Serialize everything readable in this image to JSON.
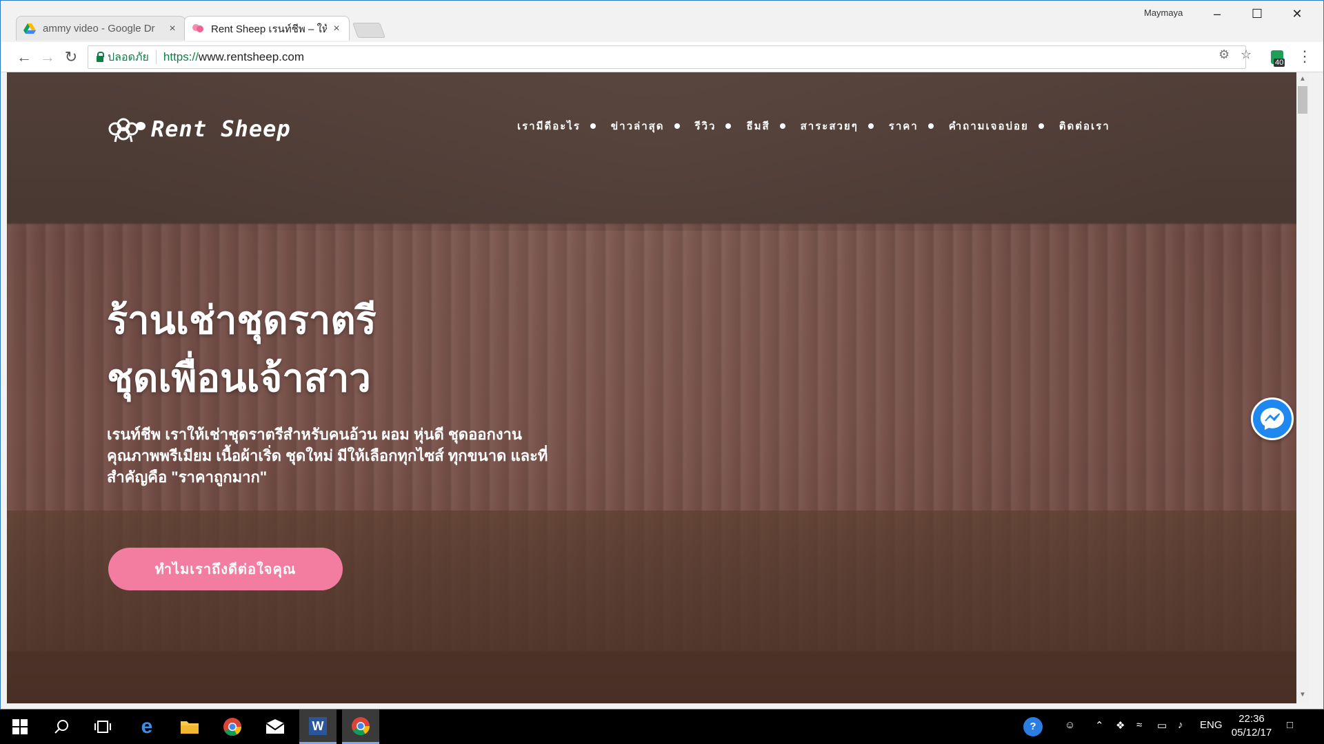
{
  "browser": {
    "user": "Maymaya",
    "tabs": [
      {
        "title": "ammy video - Google Dr",
        "close": "×"
      },
      {
        "title": "Rent Sheep เรนท์ชีพ – ให้เ",
        "close": "×"
      }
    ],
    "secure_label": "ปลอดภัย",
    "url_scheme": "https://",
    "url_host": "www.rentsheep.com",
    "extension_badge": "40"
  },
  "site": {
    "logo_text": "Rent Sheep",
    "nav": [
      "เรามีดีอะไร",
      "ข่าวล่าสุด",
      "รีวิว",
      "ธีมสี",
      "สาระสวยๆ",
      "ราคา",
      "คำถามเจอบ่อย",
      "ติดต่อเรา"
    ],
    "hero_title_line1": "ร้านเช่าชุดราตรี",
    "hero_title_line2": "ชุดเพื่อนเจ้าสาว",
    "hero_desc": "เรนท์ชีพ เราให้เช่าชุดราตรีสำหรับคนอ้วน ผอม หุ่นดี ชุดออกงาน คุณภาพพรีเมียม เนื้อผ้าเริ่ด ชุดใหม่ มีให้เลือกทุกไซส์ ทุกขนาด และที่สำคัญคือ \"ราคาถูกมาก\"",
    "cta_label": "ทำไมเราถึงดีต่อใจคุณ"
  },
  "taskbar": {
    "language": "ENG",
    "time": "22:36",
    "date": "05/12/17"
  },
  "colors": {
    "cta": "#f27da1",
    "secure": "#0b8043",
    "messenger": "#1e88f0"
  }
}
